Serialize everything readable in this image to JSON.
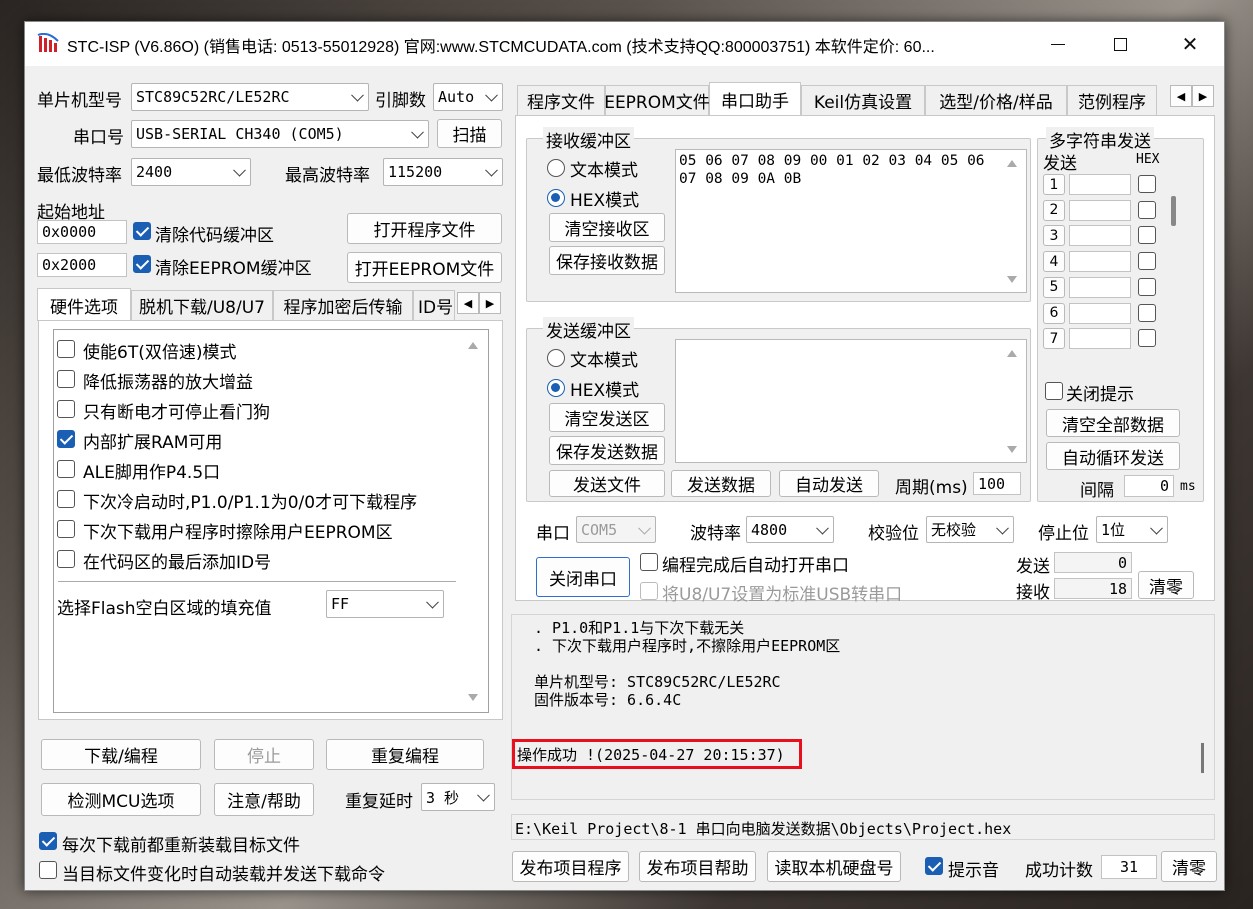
{
  "window": {
    "title": "STC-ISP (V6.86O) (销售电话: 0513-55012928) 官网:www.STCMCUDATA.com  (技术支持QQ:800003751) 本软件定价: 60..."
  },
  "left": {
    "mcu_label": "单片机型号",
    "mcu_value": "STC89C52RC/LE52RC",
    "pins_label": "引脚数",
    "pins_value": "Auto",
    "port_label": "串口号",
    "port_value": "USB-SERIAL CH340 (COM5)",
    "scan_button": "扫描",
    "min_baud_label": "最低波特率",
    "min_baud_value": "2400",
    "max_baud_label": "最高波特率",
    "max_baud_value": "115200",
    "start_addr_label": "起始地址",
    "addr1": "0x0000",
    "clear_code_label": "清除代码缓冲区",
    "open_program_button": "打开程序文件",
    "addr2": "0x2000",
    "clear_eeprom_label": "清除EEPROM缓冲区",
    "open_eeprom_button": "打开EEPROM文件",
    "tabs": [
      "硬件选项",
      "脱机下载/U8/U7",
      "程序加密后传输",
      "ID号"
    ],
    "options": [
      {
        "label": "使能6T(双倍速)模式",
        "checked": false
      },
      {
        "label": "降低振荡器的放大增益",
        "checked": false
      },
      {
        "label": "只有断电才可停止看门狗",
        "checked": false
      },
      {
        "label": "内部扩展RAM可用",
        "checked": true
      },
      {
        "label": "ALE脚用作P4.5口",
        "checked": false
      },
      {
        "label": "下次冷启动时,P1.0/P1.1为0/0才可下载程序",
        "checked": false
      },
      {
        "label": "下次下载用户程序时擦除用户EEPROM区",
        "checked": false
      },
      {
        "label": "在代码区的最后添加ID号",
        "checked": false
      }
    ],
    "flash_fill_label": "选择Flash空白区域的填充值",
    "flash_fill_value": "FF",
    "download_button": "下载/编程",
    "stop_button": "停止",
    "reprogram_button": "重复编程",
    "detect_button": "检测MCU选项",
    "help_button": "注意/帮助",
    "repeat_delay_label": "重复延时",
    "repeat_delay_value": "3 秒",
    "reload_label": "每次下载前都重新装载目标文件",
    "auto_reload_label": "当目标文件变化时自动装载并发送下载命令"
  },
  "right": {
    "tabs": [
      "程序文件",
      "EEPROM文件",
      "串口助手",
      "Keil仿真设置",
      "选型/价格/样品",
      "范例程序"
    ],
    "recv": {
      "title": "接收缓冲区",
      "text_mode": "文本模式",
      "hex_mode": "HEX模式",
      "clear_button": "清空接收区",
      "save_button": "保存接收数据",
      "content_line1": "05 06 07 08 09 00 01 02 03 04 05 06",
      "content_line2": "07 08 09 0A 0B"
    },
    "send": {
      "title": "发送缓冲区",
      "text_mode": "文本模式",
      "hex_mode": "HEX模式",
      "clear_button": "清空发送区",
      "save_button": "保存发送数据",
      "send_file_button": "发送文件",
      "send_data_button": "发送数据",
      "auto_send_button": "自动发送",
      "period_label": "周期(ms)",
      "period_value": "100"
    },
    "multi": {
      "title": "多字符串发送",
      "send_header": "发送",
      "hex_header": "HEX",
      "rows": [
        "1",
        "2",
        "3",
        "4",
        "5",
        "6",
        "7"
      ],
      "close_tip_label": "关闭提示",
      "clear_all_button": "清空全部数据",
      "auto_loop_button": "自动循环发送",
      "interval_label": "间隔",
      "interval_value": "0",
      "interval_unit": "ms"
    },
    "serial": {
      "port_label": "串口",
      "port_value": "COM5",
      "baud_label": "波特率",
      "baud_value": "4800",
      "parity_label": "校验位",
      "parity_value": "无校验",
      "stop_label": "停止位",
      "stop_value": "1位",
      "close_port_button": "关闭串口",
      "auto_open_label": "编程完成后自动打开串口",
      "u8u7_label": "将U8/U7设置为标准USB转串口",
      "send_count_label": "发送",
      "send_count": "0",
      "recv_count_label": "接收",
      "recv_count": "18",
      "clear_button": "清零"
    },
    "log": {
      "line1": ". P1.0和P1.1与下次下载无关",
      "line2": ". 下次下载用户程序时,不擦除用户EEPROM区",
      "line3": "单片机型号: STC89C52RC/LE52RC",
      "line4": "固件版本号: 6.6.4C",
      "success": "操作成功 !(2025-04-27 20:15:37)"
    },
    "path": "E:\\Keil Project\\8-1 串口向电脑发送数据\\Objects\\Project.hex",
    "bottom": {
      "publish_program_button": "发布项目程序",
      "publish_help_button": "发布项目帮助",
      "read_disk_button": "读取本机硬盘号",
      "beep_label": "提示音",
      "success_count_label": "成功计数",
      "success_count": "31",
      "clear_button": "清零"
    }
  },
  "colors": {
    "highlight_border": "#e8101c",
    "checkbox_blue": "#1a5fb4"
  }
}
